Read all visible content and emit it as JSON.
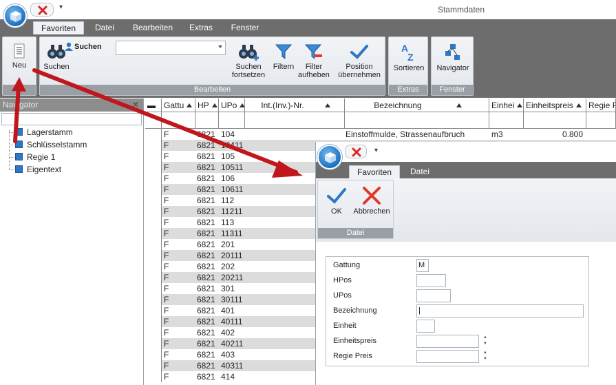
{
  "window": {
    "title": "Stammdaten"
  },
  "tabs": [
    "Favoriten",
    "Datei",
    "Bearbeiten",
    "Extras",
    "Fenster"
  ],
  "ribbon": {
    "neu_label": "Neu",
    "suchen_label": "Suchen",
    "search_combo_label": "Suchen",
    "suchen_fortsetzen": "Suchen fortsetzen",
    "filtern": "Filtern",
    "filter_aufheben": "Filter aufheben",
    "position_uebernehmen": "Position übernehmen",
    "sortieren": "Sortieren",
    "navigator": "Navigator",
    "group_bearbeiten": "Bearbeiten",
    "group_extras": "Extras",
    "group_fenster": "Fenster"
  },
  "navigator": {
    "title": "Navigator",
    "items": [
      "Lagerstamm",
      "Schlüsselstamm",
      "Regie 1",
      "Eigentext"
    ]
  },
  "grid": {
    "columns": [
      "Gattu",
      "HP",
      "UPo",
      "Int.(Inv.)-Nr.",
      "Bezeichnung",
      "Einhei",
      "Einheitspreis",
      "Regie P"
    ],
    "first_row": {
      "gattung": "F",
      "hp": "6821",
      "upo": "104",
      "bezeichnung": "Einstoffmulde, Strassenaufbruch",
      "einheit": "m3",
      "preis": "0.800"
    },
    "rows": [
      [
        "F",
        "6821",
        "104"
      ],
      [
        "F",
        "6821",
        "10411"
      ],
      [
        "F",
        "6821",
        "105"
      ],
      [
        "F",
        "6821",
        "10511"
      ],
      [
        "F",
        "6821",
        "106"
      ],
      [
        "F",
        "6821",
        "10611"
      ],
      [
        "F",
        "6821",
        "112"
      ],
      [
        "F",
        "6821",
        "11211"
      ],
      [
        "F",
        "6821",
        "113"
      ],
      [
        "F",
        "6821",
        "11311"
      ],
      [
        "F",
        "6821",
        "201"
      ],
      [
        "F",
        "6821",
        "20111"
      ],
      [
        "F",
        "6821",
        "202"
      ],
      [
        "F",
        "6821",
        "20211"
      ],
      [
        "F",
        "6821",
        "301"
      ],
      [
        "F",
        "6821",
        "30111"
      ],
      [
        "F",
        "6821",
        "401"
      ],
      [
        "F",
        "6821",
        "40111"
      ],
      [
        "F",
        "6821",
        "402"
      ],
      [
        "F",
        "6821",
        "40211"
      ],
      [
        "F",
        "6821",
        "403"
      ],
      [
        "F",
        "6821",
        "40311"
      ],
      [
        "F",
        "6821",
        "414"
      ]
    ]
  },
  "dialog": {
    "tabs": [
      "Favoriten",
      "Datei"
    ],
    "ok_label": "OK",
    "abbrechen_label": "Abbrechen",
    "group_label": "Datei",
    "form": {
      "gattung_label": "Gattung",
      "gattung_value": "M",
      "hpos_label": "HPos",
      "upos_label": "UPos",
      "bezeichnung_label": "Bezeichnung",
      "einheit_label": "Einheit",
      "einheitspreis_label": "Einheitspreis",
      "regie_preis_label": "Regie Preis"
    }
  },
  "colors": {
    "ribbon_dark": "#6d6d6d",
    "accent_blue": "#2e77c2",
    "arrow_red": "#c0171c",
    "cancel_red": "#e0392b"
  }
}
